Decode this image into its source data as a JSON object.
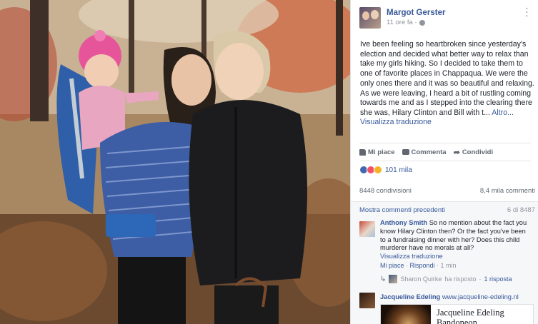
{
  "post": {
    "author": "Margot Gerster",
    "time": "11 ore fa ·",
    "text": "Ive been feeling so heartbroken since yesterday's election and decided what better way to relax than take my girls hiking. So I decided to take them to one of favorite places in Chappaqua. We were the only ones there and it was so beautiful and relaxing. As we were leaving, I heard a bit of rustling coming towards me and as I stepped into the clearing there she was, Hilary Clinton and Bill with t...",
    "more": "Altro...",
    "translate": "Visualizza traduzione"
  },
  "actions": {
    "like": "Mi piace",
    "comment": "Commenta",
    "share": "Condividi"
  },
  "reactions": {
    "count": "101 mila",
    "types": [
      "like-icon",
      "love-icon",
      "wow-icon"
    ]
  },
  "stats": {
    "shares": "8448 condivisioni",
    "comments": "8,4 mila commenti"
  },
  "comments_section": {
    "prev_link": "Mostra commenti precedenti",
    "prev_count": "6 di 8487",
    "comment1": {
      "author": "Anthony Smith",
      "text": "So no mention about the fact you know Hilary Clinton then? Or the fact you've been to a fundraising dinner with her? Does this child murderer have no morals at all?",
      "translate": "Visualizza traduzione",
      "like": "Mi piace",
      "reply": "Rispondi",
      "time": "1 min",
      "reply_author": "Sharon Quirke",
      "reply_action": "ha risposto",
      "reply_count": "1 risposta"
    },
    "comment2": {
      "author": "Jacqueline Edeling",
      "site": "www.jacqueline-edeling.nl",
      "embed_title": "Jacqueline Edeling",
      "embed_sub": "Bandoneon"
    }
  },
  "colors": {
    "link": "#365899",
    "muted": "#90949c",
    "text": "#1d2129"
  }
}
